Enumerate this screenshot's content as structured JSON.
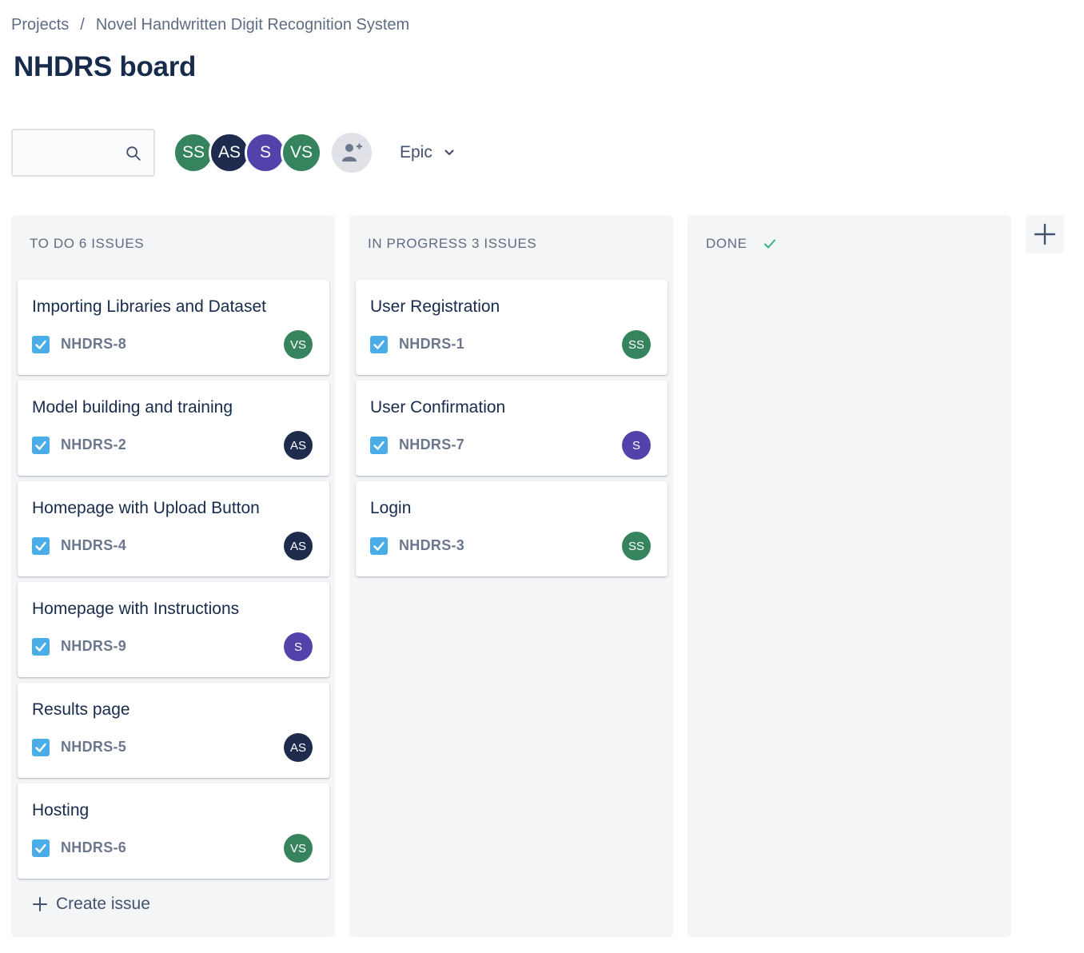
{
  "breadcrumb": {
    "items": [
      "Projects",
      "Novel Handwritten Digit Recognition System"
    ],
    "separator": "/"
  },
  "page": {
    "title": "NHDRS board"
  },
  "search": {
    "value": "",
    "placeholder": ""
  },
  "members": [
    {
      "initials": "SS",
      "color": "#36845e"
    },
    {
      "initials": "AS",
      "color": "#1e2b4d"
    },
    {
      "initials": "S",
      "color": "#5243aa"
    },
    {
      "initials": "VS",
      "color": "#36845e"
    }
  ],
  "filter": {
    "label": "Epic"
  },
  "columns": [
    {
      "name": "TO DO",
      "count_label": "6 ISSUES",
      "create_label": "Create issue",
      "cards": [
        {
          "title": "Importing Libraries and Dataset",
          "key": "NHDRS-8",
          "assignee": "VS",
          "assignee_color": "#36845e"
        },
        {
          "title": "Model building and training",
          "key": "NHDRS-2",
          "assignee": "AS",
          "assignee_color": "#1e2b4d"
        },
        {
          "title": "Homepage with Upload Button",
          "key": "NHDRS-4",
          "assignee": "AS",
          "assignee_color": "#1e2b4d"
        },
        {
          "title": "Homepage with Instructions",
          "key": "NHDRS-9",
          "assignee": "S",
          "assignee_color": "#5243aa"
        },
        {
          "title": "Results page",
          "key": "NHDRS-5",
          "assignee": "AS",
          "assignee_color": "#1e2b4d"
        },
        {
          "title": "Hosting",
          "key": "NHDRS-6",
          "assignee": "VS",
          "assignee_color": "#36845e"
        }
      ]
    },
    {
      "name": "IN PROGRESS",
      "count_label": "3 ISSUES",
      "cards": [
        {
          "title": "User Registration",
          "key": "NHDRS-1",
          "assignee": "SS",
          "assignee_color": "#36845e"
        },
        {
          "title": "User Confirmation",
          "key": "NHDRS-7",
          "assignee": "S",
          "assignee_color": "#5243aa"
        },
        {
          "title": "Login",
          "key": "NHDRS-3",
          "assignee": "SS",
          "assignee_color": "#36845e"
        }
      ]
    },
    {
      "name": "DONE",
      "count_label": "",
      "cards": []
    }
  ],
  "icons": {
    "search": "search-icon",
    "add_people": "add-person-icon",
    "filter_chevron": "chevron-down-icon",
    "done_check": "checkmark-icon",
    "task": "task-checkbox-icon",
    "add_column": "plus-icon",
    "create": "plus-icon"
  },
  "colors": {
    "task_icon": "#4bade8",
    "done_check": "#36b37e",
    "column_bg": "#f4f5f7"
  }
}
